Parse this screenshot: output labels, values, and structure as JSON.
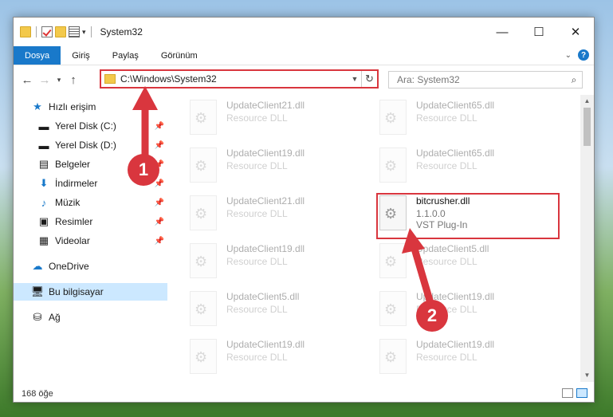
{
  "window": {
    "title": "System32",
    "controls": {
      "minimize": "—",
      "maximize": "☐",
      "close": "✕"
    }
  },
  "ribbon": {
    "tabs": [
      "Dosya",
      "Giriş",
      "Paylaş",
      "Görünüm"
    ],
    "help": "?"
  },
  "nav": {
    "address": "C:\\Windows\\System32",
    "search_placeholder": "Ara: System32"
  },
  "sidebar": {
    "items": [
      {
        "label": "Hızlı erişim",
        "icon": "star-icon",
        "pinned": false
      },
      {
        "label": "Yerel Disk (C:)",
        "icon": "drive-icon",
        "pinned": true
      },
      {
        "label": "Yerel Disk (D:)",
        "icon": "drive-icon",
        "pinned": true
      },
      {
        "label": "Belgeler",
        "icon": "document-icon",
        "pinned": true
      },
      {
        "label": "İndirmeler",
        "icon": "download-icon",
        "pinned": true
      },
      {
        "label": "Müzik",
        "icon": "music-icon",
        "pinned": true
      },
      {
        "label": "Resimler",
        "icon": "pictures-icon",
        "pinned": true
      },
      {
        "label": "Videolar",
        "icon": "video-icon",
        "pinned": true
      },
      {
        "label": "OneDrive",
        "icon": "cloud-icon",
        "pinned": false
      },
      {
        "label": "Bu bilgisayar",
        "icon": "computer-icon",
        "pinned": false
      },
      {
        "label": "Ağ",
        "icon": "network-icon",
        "pinned": false
      }
    ]
  },
  "files": [
    {
      "name": "UpdateClient21.dll",
      "desc": "Resource DLL",
      "faded": true
    },
    {
      "name": "UpdateClient65.dll",
      "desc": "Resource DLL",
      "faded": true
    },
    {
      "name": "UpdateClient19.dll",
      "desc": "Resource DLL",
      "faded": true
    },
    {
      "name": "UpdateClient65.dll",
      "desc": "Resource DLL",
      "faded": true
    },
    {
      "name": "UpdateClient21.dll",
      "desc": "Resource DLL",
      "faded": true
    },
    {
      "name": "bitcrusher.dll",
      "desc": "1.1.0.0",
      "desc2": "VST Plug-In",
      "faded": false
    },
    {
      "name": "UpdateClient19.dll",
      "desc": "Resource DLL",
      "faded": true
    },
    {
      "name": "UpdateClient5.dll",
      "desc": "Resource DLL",
      "faded": true
    },
    {
      "name": "UpdateClient5.dll",
      "desc": "Resource DLL",
      "faded": true
    },
    {
      "name": "UpdateClient19.dll",
      "desc": "Resource DLL",
      "faded": true
    },
    {
      "name": "UpdateClient19.dll",
      "desc": "Resource DLL",
      "faded": true
    },
    {
      "name": "UpdateClient19.dll",
      "desc": "Resource DLL",
      "faded": true
    }
  ],
  "status": {
    "count": "168 öğe"
  },
  "annotations": {
    "badge1": "1",
    "badge2": "2",
    "color": "#d9363e"
  }
}
